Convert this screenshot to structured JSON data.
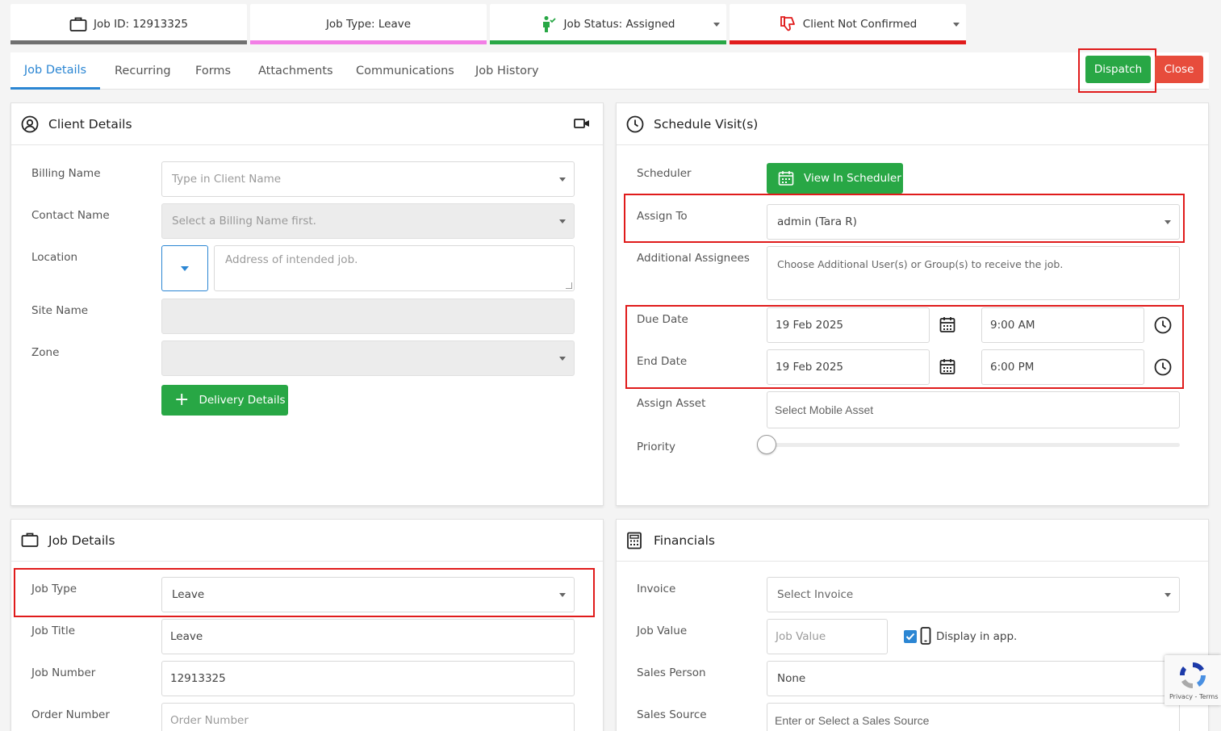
{
  "top_cards": {
    "job_id": "Job ID: 12913325",
    "job_type": "Job Type: Leave",
    "job_status": "Job Status: Assigned",
    "client_confirm": "Client Not Confirmed"
  },
  "tabs": [
    "Job Details",
    "Recurring",
    "Forms",
    "Attachments",
    "Communications",
    "Job History"
  ],
  "actions": {
    "dispatch": "Dispatch",
    "close": "Close"
  },
  "client_details": {
    "title": "Client Details",
    "billing_name_label": "Billing Name",
    "billing_name_placeholder": "Type in Client Name",
    "contact_name_label": "Contact Name",
    "contact_name_placeholder": "Select a Billing Name first.",
    "location_label": "Location",
    "location_placeholder": "Address of intended job.",
    "site_name_label": "Site Name",
    "zone_label": "Zone",
    "delivery_button": "Delivery Details"
  },
  "schedule": {
    "title": "Schedule Visit(s)",
    "scheduler_label": "Scheduler",
    "view_scheduler_button": "View In Scheduler",
    "assign_to_label": "Assign To",
    "assign_to_value": "admin (Tara R)",
    "additional_label": "Additional Assignees",
    "additional_placeholder": "Choose Additional User(s) or Group(s) to receive the job.",
    "due_date_label": "Due Date",
    "due_date": "19 Feb 2025",
    "due_time": "9:00 AM",
    "end_date_label": "End Date",
    "end_date": "19 Feb 2025",
    "end_time": "6:00 PM",
    "asset_label": "Assign Asset",
    "asset_placeholder": "Select Mobile Asset",
    "priority_label": "Priority",
    "priority_level": 0
  },
  "job_details": {
    "title": "Job Details",
    "job_type_label": "Job Type",
    "job_type_value": "Leave",
    "job_title_label": "Job Title",
    "job_title_value": "Leave",
    "job_number_label": "Job Number",
    "job_number_value": "12913325",
    "order_number_label": "Order Number",
    "order_number_placeholder": "Order Number"
  },
  "financials": {
    "title": "Financials",
    "invoice_label": "Invoice",
    "invoice_placeholder": "Select Invoice",
    "job_value_label": "Job Value",
    "job_value_placeholder": "Job Value",
    "display_in_app": "Display in app.",
    "display_in_app_checked": true,
    "sales_person_label": "Sales Person",
    "sales_person_value": "None",
    "sales_source_label": "Sales Source",
    "sales_source_placeholder": "Enter or Select a Sales Source"
  },
  "recaptcha": {
    "text": "Privacy - Terms"
  },
  "colors": {
    "primary_blue": "#2b86d3",
    "green": "#28a745",
    "red": "#e74c3c",
    "highlight_red": "#e01b1b",
    "pink": "#f27ee6"
  }
}
